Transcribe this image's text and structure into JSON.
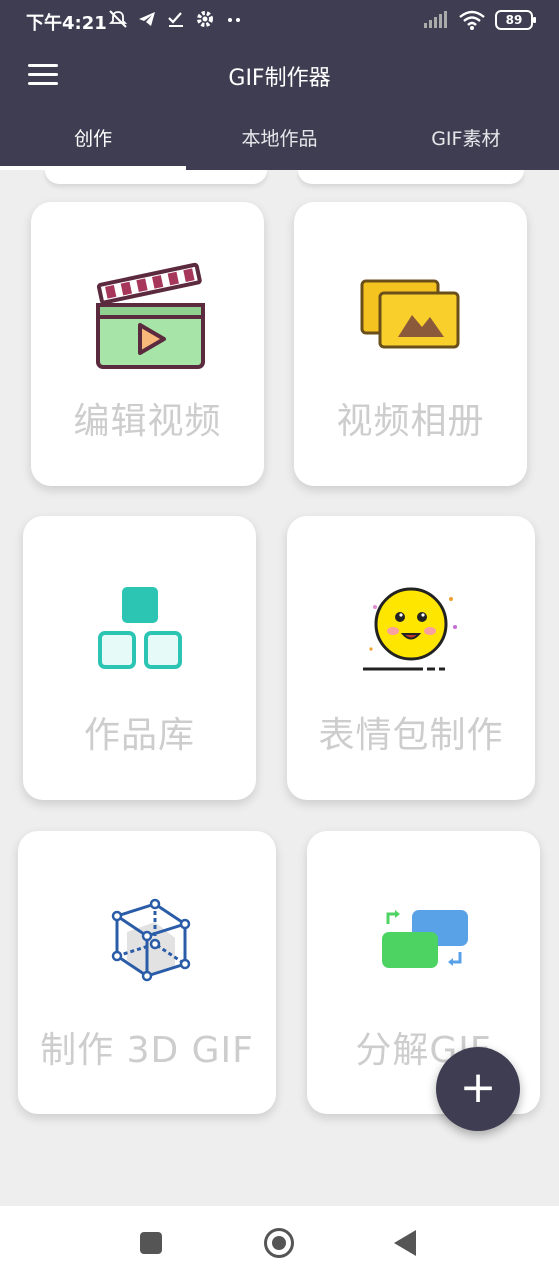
{
  "status_bar": {
    "time": "下午4:21",
    "battery": "89"
  },
  "app_bar": {
    "title": "GIF制作器"
  },
  "tabs": [
    {
      "label": "创作",
      "active": true
    },
    {
      "label": "本地作品",
      "active": false
    },
    {
      "label": "GIF素材",
      "active": false
    }
  ],
  "cards": [
    {
      "label": "编辑视频",
      "icon": "clapperboard-icon"
    },
    {
      "label": "视频相册",
      "icon": "photo-album-icon"
    },
    {
      "label": "作品库",
      "icon": "works-library-icon"
    },
    {
      "label": "表情包制作",
      "icon": "smiley-face-icon"
    },
    {
      "label": "制作 3D GIF",
      "icon": "3d-cube-icon"
    },
    {
      "label": "分解GIF",
      "icon": "split-gif-icon"
    }
  ],
  "fab": {
    "label": "+"
  },
  "colors": {
    "header_bg": "#3f3d52",
    "content_bg": "#eeeeee",
    "card_label": "#cdcdcd"
  }
}
